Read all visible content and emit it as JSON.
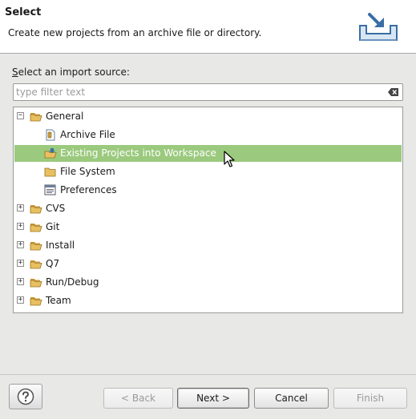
{
  "banner": {
    "title": "Select",
    "description": "Create new projects from an archive file or directory."
  },
  "source_label": {
    "mnemonic": "S",
    "rest": "elect an import source:"
  },
  "filter": {
    "value": "",
    "placeholder": "type filter text"
  },
  "tree": [
    {
      "label": "General",
      "expanded": true,
      "icon": "folder-open-icon"
    },
    {
      "label": "Archive File",
      "icon": "archive-file-icon"
    },
    {
      "label": "Existing Projects into Workspace",
      "icon": "existing-projects-icon",
      "selected": true
    },
    {
      "label": "File System",
      "icon": "file-system-folder-icon"
    },
    {
      "label": "Preferences",
      "icon": "preferences-icon"
    },
    {
      "label": "CVS",
      "expanded": false,
      "icon": "folder-open-icon"
    },
    {
      "label": "Git",
      "expanded": false,
      "icon": "folder-open-icon"
    },
    {
      "label": "Install",
      "expanded": false,
      "icon": "folder-open-icon"
    },
    {
      "label": "Q7",
      "expanded": false,
      "icon": "folder-open-icon"
    },
    {
      "label": "Run/Debug",
      "expanded": false,
      "icon": "folder-open-icon"
    },
    {
      "label": "Team",
      "expanded": false,
      "icon": "folder-open-icon"
    }
  ],
  "buttons": {
    "back": {
      "label": "< Back",
      "enabled": false
    },
    "next": {
      "label": "Next >",
      "enabled": true
    },
    "cancel": {
      "label": "Cancel",
      "enabled": true
    },
    "finish": {
      "label": "Finish",
      "enabled": false
    }
  },
  "colors": {
    "selection": "#9bc97e",
    "folder": "#e8c060"
  }
}
